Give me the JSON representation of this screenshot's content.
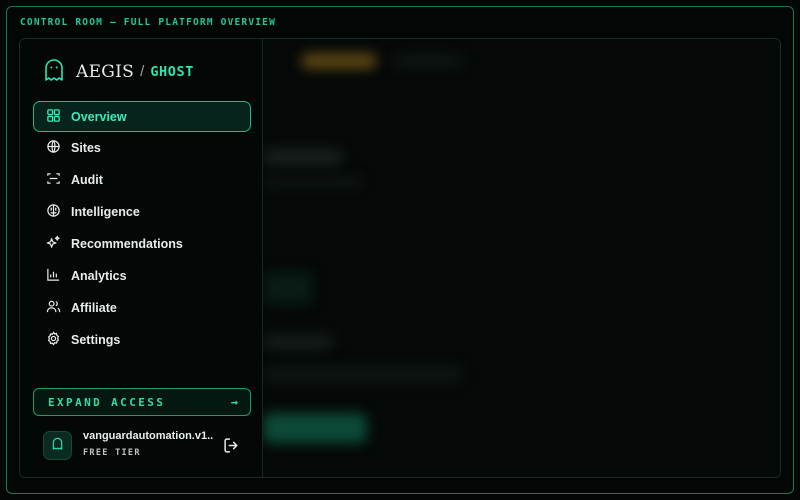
{
  "frame": {
    "title": "CONTROL ROOM — FULL PLATFORM OVERVIEW"
  },
  "brand": {
    "name": "AEGIS",
    "separator": "/",
    "sub": "GHOST",
    "icon": "ghost-icon"
  },
  "nav": {
    "active": "Overview",
    "items": [
      {
        "label": "Overview",
        "icon": "grid-icon"
      },
      {
        "label": "Sites",
        "icon": "globe-icon"
      },
      {
        "label": "Audit",
        "icon": "scan-icon"
      },
      {
        "label": "Intelligence",
        "icon": "brain-icon"
      },
      {
        "label": "Recommendations",
        "icon": "sparkles-icon"
      },
      {
        "label": "Analytics",
        "icon": "bar-chart-icon"
      },
      {
        "label": "Affiliate",
        "icon": "users-icon"
      },
      {
        "label": "Settings",
        "icon": "gear-icon"
      }
    ]
  },
  "expand": {
    "label": "EXPAND ACCESS",
    "arrow": "→"
  },
  "user": {
    "name": "vanguardautomation.v1...",
    "tier": "FREE TIER",
    "icon": "ghost-icon",
    "logout_icon": "logout-icon"
  },
  "colors": {
    "accent": "#2ee6b0",
    "frame": "#0f7a5c",
    "background": "#020605"
  }
}
